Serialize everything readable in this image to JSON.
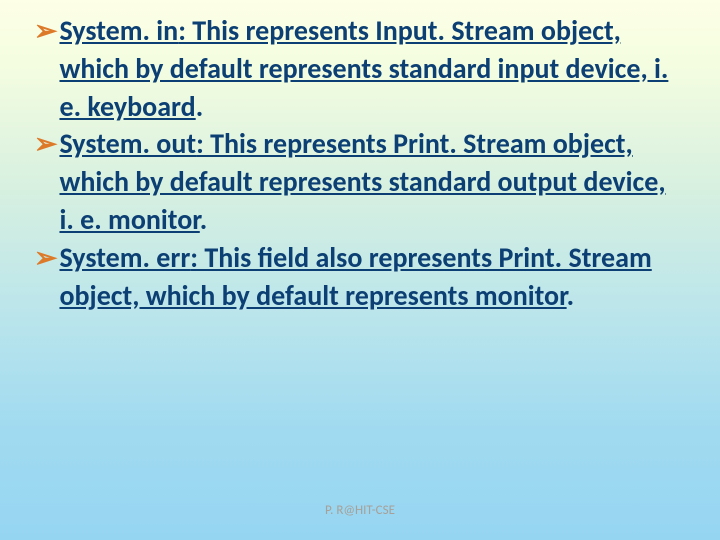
{
  "bullets": [
    {
      "marker": "➢",
      "term": "System. in",
      "rest": ": This represents Input. Stream object, which by default represents standard input device, i. e. keyboard",
      "tail": "."
    },
    {
      "marker": "➢",
      "term": "System. out",
      "rest": ": This represents Print. Stream object, which by default represents standard output device, i. e. monitor",
      "tail": "."
    },
    {
      "marker": "➢",
      "term": "System. err",
      "rest": ": This field also represents Print. Stream object, which by default represents monitor",
      "tail": "."
    }
  ],
  "footer": "P. R@HIT-CSE"
}
